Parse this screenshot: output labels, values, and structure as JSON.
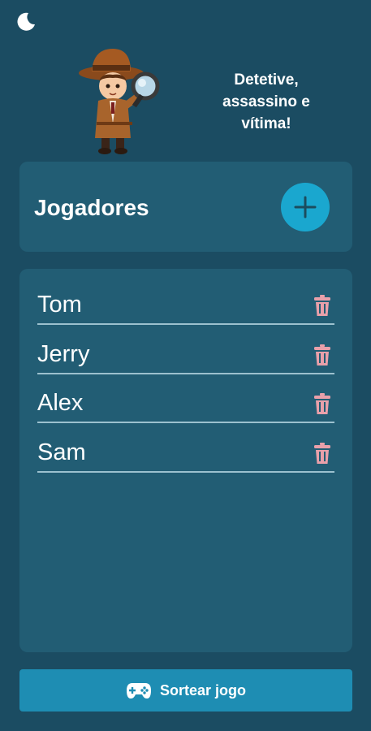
{
  "header": {
    "title": "Detetive,\nassassino e\nvítima!",
    "theme_icon": "moon-icon",
    "mascot": "detective-mascot-image"
  },
  "players_card": {
    "title": "Jogadores",
    "add_icon": "plus-icon"
  },
  "players": [
    {
      "name": "Tom"
    },
    {
      "name": "Jerry"
    },
    {
      "name": "Alex"
    },
    {
      "name": "Sam"
    }
  ],
  "actions": {
    "draw_label": "Sortear jogo",
    "draw_icon": "gamepad-icon"
  },
  "colors": {
    "background": "#1b4c62",
    "card": "#225d74",
    "accent": "#1aa7cf",
    "primary_button": "#1e8db3",
    "delete": "#e9a0aa"
  }
}
